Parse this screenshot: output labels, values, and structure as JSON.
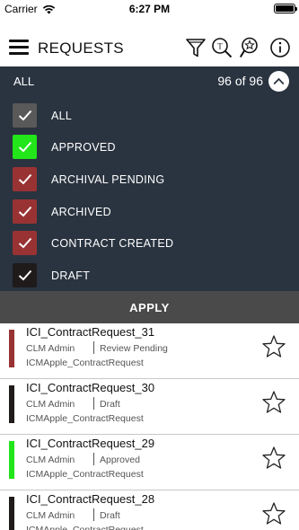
{
  "status_bar": {
    "carrier": "Carrier",
    "time": "6:27 PM"
  },
  "header": {
    "title": "REQUESTS"
  },
  "filter_bar": {
    "selected": "ALL",
    "count": "96 of 96"
  },
  "filters": [
    {
      "label": "ALL",
      "color": "#595959"
    },
    {
      "label": "APPROVED",
      "color": "#22e61a"
    },
    {
      "label": "ARCHIVAL PENDING",
      "color": "#993333"
    },
    {
      "label": "ARCHIVED",
      "color": "#993333"
    },
    {
      "label": "CONTRACT CREATED",
      "color": "#993333"
    },
    {
      "label": "DRAFT",
      "color": "#1f1b1b"
    }
  ],
  "apply_label": "APPLY",
  "requests": [
    {
      "title": "ICI_ContractRequest_31",
      "user": "CLM Admin",
      "status": "Review Pending",
      "type": "ICMApple_ContractRequest",
      "color": "#993333"
    },
    {
      "title": "ICI_ContractRequest_30",
      "user": "CLM Admin",
      "status": "Draft",
      "type": "ICMApple_ContractRequest",
      "color": "#1f1b1b"
    },
    {
      "title": "ICI_ContractRequest_29",
      "user": "CLM Admin",
      "status": "Approved",
      "type": "ICMApple_ContractRequest",
      "color": "#22e61a"
    },
    {
      "title": "ICI_ContractRequest_28",
      "user": "CLM Admin",
      "status": "Draft",
      "type": "ICMApple_ContractRequest",
      "color": "#1f1b1b"
    }
  ]
}
